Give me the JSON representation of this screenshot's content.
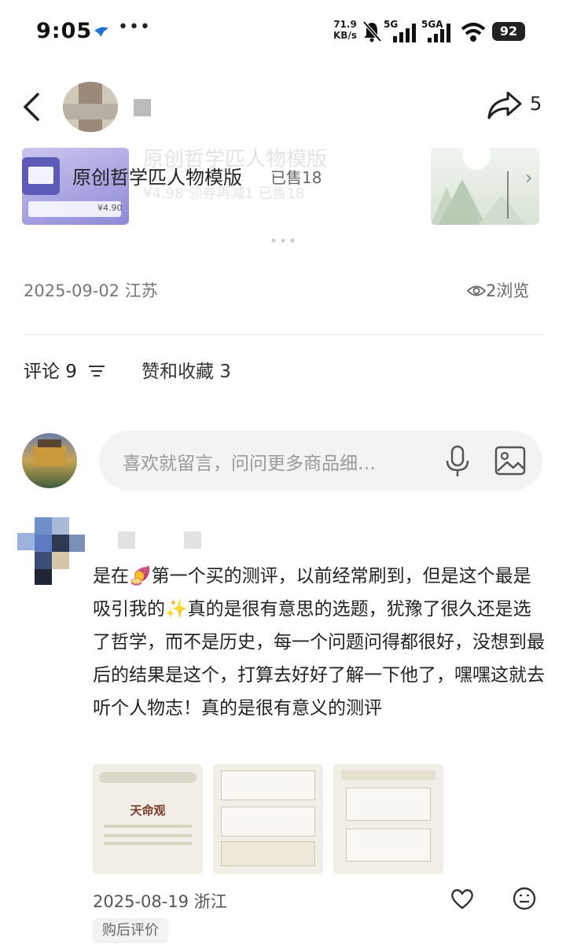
{
  "status_bar": {
    "time": "9:05",
    "speed_value": "71.9",
    "speed_unit": "KB/s",
    "sig1": "5G",
    "sig2": "5GA",
    "battery": "92"
  },
  "nav": {
    "share_count": "5"
  },
  "product": {
    "title": "原创哲学匹人物模版",
    "sold": "已售18",
    "ghost_title": "原创哲学匹人物模版",
    "ghost_price": "¥4.98  领券再减1  已售18",
    "card_price": "¥4.90"
  },
  "post_meta": {
    "date_location": "2025-09-02 江苏",
    "views": "2浏览"
  },
  "tabs": {
    "comments": "评论 9",
    "likes": "赞和收藏 3"
  },
  "comment_input": {
    "placeholder": "喜欢就留言，问问更多商品细…"
  },
  "comment": {
    "text": "是在🍠第一个买的测评，以前经常刷到，但是这个最是吸引我的✨真的是很有意思的选题，犹豫了很久还是选了哲学，而不是历史，每一个问题问得都很好，没想到最后的结果是这个，打算去好好了解一下他了，嘿嘿这就去听个人物志！真的是很有意义的测评",
    "image1_title": "天命观",
    "date_location": "2025-08-19 浙江",
    "tag": "购后评价"
  }
}
